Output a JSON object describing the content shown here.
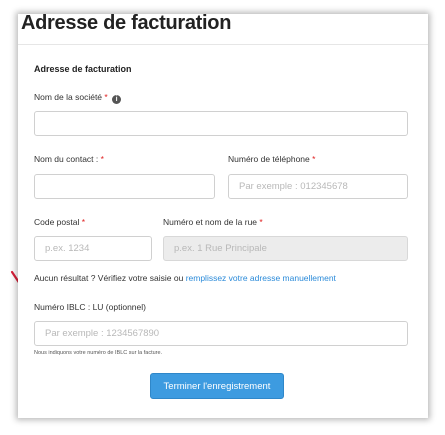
{
  "header": {
    "title": "Adresse de facturation"
  },
  "form": {
    "section_title": "Adresse de facturation",
    "company": {
      "label": "Nom de la société",
      "required_mark": "*",
      "info_icon_glyph": "i",
      "value": "",
      "placeholder": ""
    },
    "contact": {
      "label": "Nom du contact :",
      "required_mark": "*",
      "value": "",
      "placeholder": ""
    },
    "phone": {
      "label": "Numéro de téléphone",
      "required_mark": "*",
      "value": "",
      "placeholder": "Par exemple : 012345678"
    },
    "postal_code": {
      "label": "Code postal",
      "required_mark": "*",
      "value": "",
      "placeholder": "p.ex. 1234"
    },
    "street": {
      "label": "Numéro et nom de la rue",
      "required_mark": "*",
      "value": "",
      "placeholder": "p.ex. 1 Rue Principale",
      "disabled": true
    },
    "no_result": {
      "text": "Aucun résultat ? Vérifiez votre saisie ou",
      "link_text": "remplissez votre adresse manuellement"
    },
    "iblc": {
      "label": "Numéro IBLC : LU (optionnel)",
      "value": "",
      "placeholder": "Par exemple : 1234567890",
      "note": "Nous indiquons votre numéro de IBLC sur la facture."
    },
    "submit_label": "Terminer l'enregistrement"
  },
  "colors": {
    "required": "#e02020",
    "link": "#2a8ad9",
    "button": "#3d9be0",
    "arrow": "#d9213a"
  },
  "icons": {
    "info": "info-circle-icon",
    "annotation_arrow": "red-arrow-icon"
  }
}
